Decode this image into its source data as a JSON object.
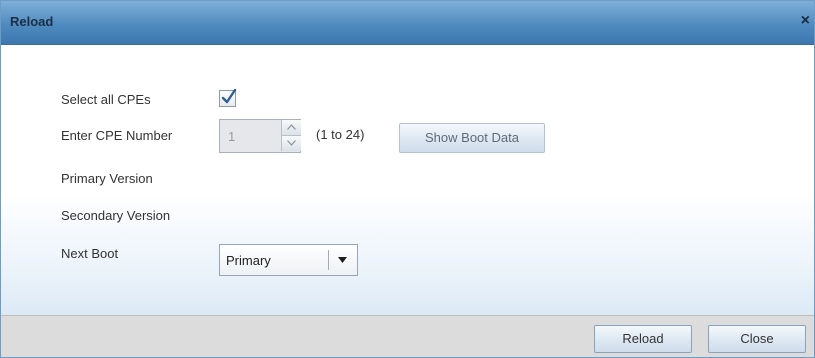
{
  "dialog": {
    "title": "Reload",
    "close_glyph": "×"
  },
  "form": {
    "select_all_label": "Select all CPEs",
    "select_all_checked": true,
    "cpe_number_label": "Enter CPE Number",
    "cpe_number_value": "1",
    "cpe_range_hint": "(1 to 24)",
    "show_boot_label": "Show Boot Data",
    "primary_version_label": "Primary Version",
    "secondary_version_label": "Secondary Version",
    "next_boot_label": "Next Boot",
    "next_boot_value": "Primary"
  },
  "footer": {
    "reload_label": "Reload",
    "close_label": "Close"
  },
  "icons": {
    "checkmark": "check-icon",
    "spin_up": "chevron-up-icon",
    "spin_down": "chevron-down-icon",
    "dropdown": "caret-down-icon",
    "close": "close-icon"
  },
  "colors": {
    "titlebar": "#4f8bbf",
    "footer": "#dcdcdc",
    "button": "#dbe6f1"
  }
}
